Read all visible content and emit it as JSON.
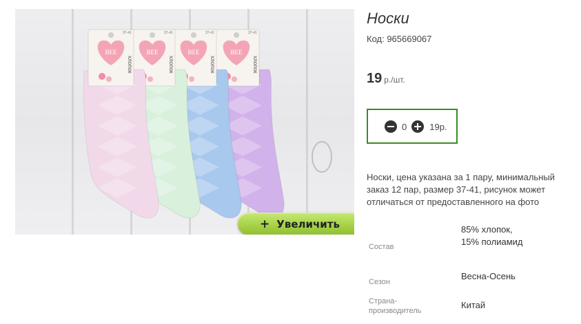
{
  "product": {
    "title": "Носки",
    "code": "Код: 965669067",
    "price_value": "19",
    "price_unit": "р./шт.",
    "description": "Носки, цена указана за 1 пару, минимальный заказ 12 пар, размер 37-41, рисунок может отличаться от предоставленного на фото"
  },
  "image": {
    "zoom_plus": "+",
    "zoom_label": "Увеличить",
    "tag_brand": "BEE",
    "tag_text": "хлопок",
    "tag_size": "37-41",
    "colors": {
      "sock_pink": "#f2d9ea",
      "sock_mint": "#d8f0dc",
      "sock_blue": "#a8c8ee",
      "sock_purple": "#d2b2ea",
      "tag_bg": "#f7f3ee",
      "heart": "#f3a5b5",
      "button_green": "#a7d248"
    }
  },
  "cart": {
    "minus_icon": "minus-circle-icon",
    "plus_icon": "plus-circle-icon",
    "quantity": "0",
    "total": "19р."
  },
  "properties": [
    {
      "label": "Состав",
      "value": "85% хлопок, 15% полиамид"
    },
    {
      "label": "Сезон",
      "value": "Весна-Осень"
    },
    {
      "label": "Страна-производитель",
      "value": "Китай"
    }
  ]
}
